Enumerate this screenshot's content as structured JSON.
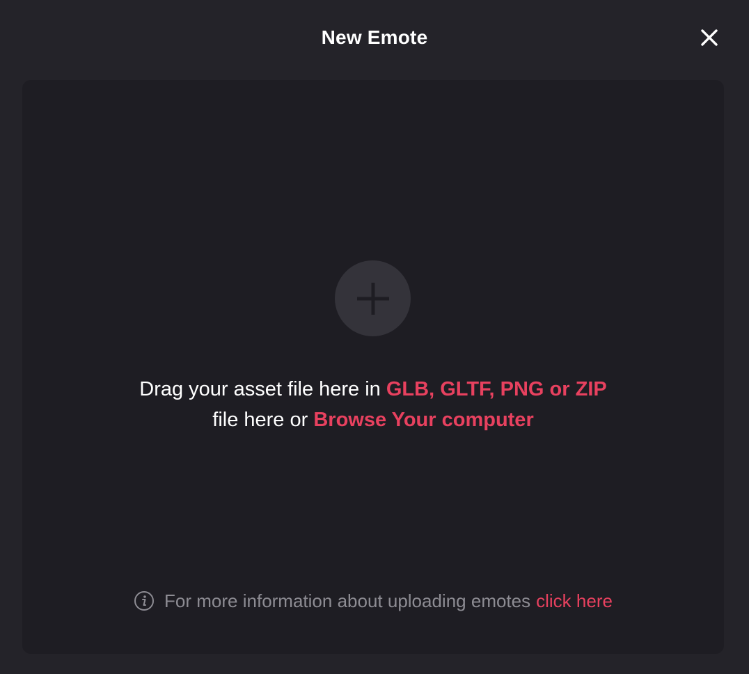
{
  "modal": {
    "title": "New Emote",
    "close_icon": "close-icon"
  },
  "dropzone": {
    "add_icon": "plus-icon",
    "line1_prefix": "Drag your asset file here in ",
    "formats": "GLB, GLTF, PNG or ZIP",
    "line2_prefix": "file here or ",
    "browse_label": "Browse Your computer"
  },
  "info": {
    "icon": "info-icon",
    "text": "For more information about uploading emotes",
    "link_label": "click here"
  },
  "colors": {
    "background": "#242329",
    "dropzone": "#1e1d23",
    "accent": "#e8415f",
    "muted_text": "#8d8c93",
    "add_circle": "#34333a"
  }
}
